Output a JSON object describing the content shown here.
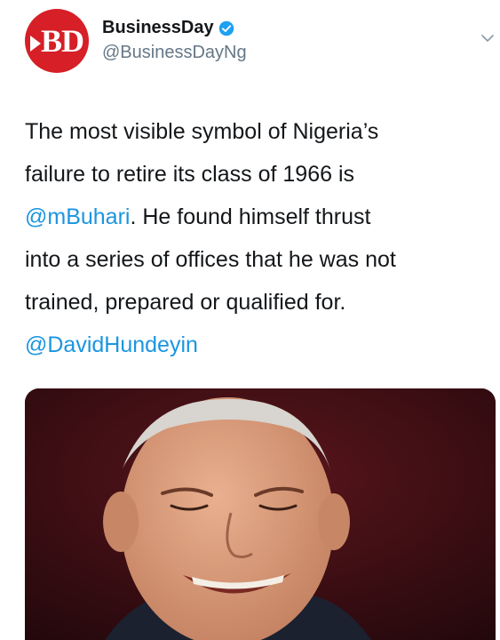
{
  "tweet": {
    "author": {
      "avatar_text": "BD",
      "display_name": "BusinessDay",
      "handle": "@BusinessDayNg",
      "verified": true,
      "verified_icon": "verified-badge-icon",
      "brand_color": "#d61f26"
    },
    "menu_icon": "chevron-down-icon",
    "text": {
      "line1": "The most visible symbol of Nigeria’s",
      "line2": "failure to retire its class of 1966 is",
      "mention1": "@mBuhari",
      "line3_rest": ". He found himself thrust",
      "line4": "into a series of offices that he was not",
      "line5": "trained, prepared or qualified for.",
      "mention2": "@DavidHundeyin"
    },
    "colors": {
      "text": "#14171a",
      "muted": "#657786",
      "link": "#1b95e0",
      "verified": "#1da1f2"
    },
    "media": {
      "type": "photo"
    }
  }
}
